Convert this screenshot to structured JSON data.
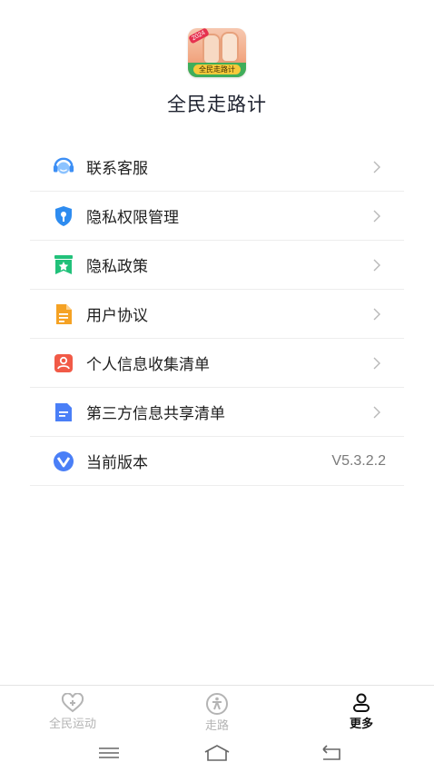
{
  "app": {
    "name": "全民走路计",
    "logo_text": "全民走路计",
    "logo_year": "2024"
  },
  "menu": [
    {
      "label": "联系客服",
      "icon": "customer-service-icon",
      "color": "#3d8ff5"
    },
    {
      "label": "隐私权限管理",
      "icon": "privacy-shield-icon",
      "color": "#2e8cf0"
    },
    {
      "label": "隐私政策",
      "icon": "policy-bookmark-icon",
      "color": "#21c17a"
    },
    {
      "label": "用户协议",
      "icon": "agreement-document-icon",
      "color": "#f5a224"
    },
    {
      "label": "个人信息收集清单",
      "icon": "personal-info-icon",
      "color": "#f15a47"
    },
    {
      "label": "第三方信息共享清单",
      "icon": "third-party-list-icon",
      "color": "#4a7ff7"
    },
    {
      "label": "当前版本",
      "icon": "version-v-icon",
      "color": "#4a7ff7",
      "value": "V5.3.2.2"
    }
  ],
  "tabbar": {
    "tabs": [
      {
        "label": "全民运动",
        "icon": "heart-plus-icon",
        "active": false
      },
      {
        "label": "走路",
        "icon": "walk-icon",
        "active": false
      },
      {
        "label": "更多",
        "icon": "user-icon",
        "active": true
      }
    ]
  },
  "system_nav": [
    "menu-icon",
    "home-icon",
    "back-icon"
  ],
  "colors": {
    "active_tab": "#111111",
    "inactive_tab": "#b4b4b4",
    "divider": "#ededed"
  }
}
